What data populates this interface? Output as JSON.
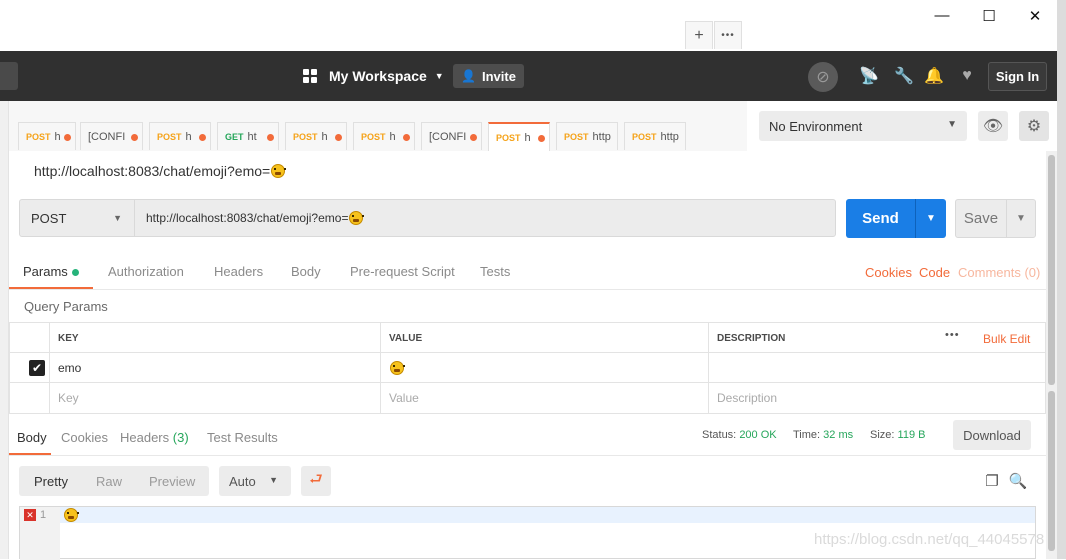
{
  "window": {
    "minimize": "—",
    "maximize": "☐",
    "close": "✕"
  },
  "header": {
    "workspace_label": "My Workspace",
    "invite_label": "Invite",
    "signin_label": "Sign In"
  },
  "tabs": [
    {
      "method": "POST",
      "url": "h",
      "dot": true
    },
    {
      "method": "",
      "url": "[CONFI",
      "dot": true
    },
    {
      "method": "POST",
      "url": "h",
      "dot": true
    },
    {
      "method": "GET",
      "url": "ht",
      "dot": true
    },
    {
      "method": "POST",
      "url": "h",
      "dot": true
    },
    {
      "method": "POST",
      "url": "h",
      "dot": true
    },
    {
      "method": "",
      "url": "[CONFI",
      "dot": true
    },
    {
      "method": "POST",
      "url": "h",
      "dot": true,
      "active": true
    },
    {
      "method": "POST",
      "url": "http",
      "dot": false
    },
    {
      "method": "POST",
      "url": "http",
      "dot": false
    }
  ],
  "tab_actions": {
    "add": "+",
    "more": "•••"
  },
  "environment": {
    "selected": "No Environment"
  },
  "request": {
    "title": "http://localhost:8083/chat/emoji?emo=",
    "method": "POST",
    "url": "http://localhost:8083/chat/emoji?emo=",
    "send_label": "Send",
    "save_label": "Save"
  },
  "request_tabs": [
    "Params",
    "Authorization",
    "Headers",
    "Body",
    "Pre-request Script",
    "Tests"
  ],
  "request_links": {
    "cookies": "Cookies",
    "code": "Code",
    "comments": "Comments (0)"
  },
  "query_params": {
    "title": "Query Params",
    "columns": {
      "key": "KEY",
      "value": "VALUE",
      "description": "DESCRIPTION"
    },
    "bulk_edit": "Bulk Edit",
    "row": {
      "key": "emo",
      "checked": true
    },
    "placeholders": {
      "key": "Key",
      "value": "Value",
      "description": "Description"
    }
  },
  "response": {
    "tabs": {
      "body": "Body",
      "cookies": "Cookies",
      "headers": "Headers",
      "headers_count": "(3)",
      "tests": "Test Results"
    },
    "status_label": "Status:",
    "status_value": "200 OK",
    "time_label": "Time:",
    "time_value": "32 ms",
    "size_label": "Size:",
    "size_value": "119 B",
    "download_label": "Download",
    "formats": [
      "Pretty",
      "Raw",
      "Preview"
    ],
    "auto_label": "Auto",
    "line_number": "1"
  },
  "watermark": "https://blog.csdn.net/qq_44045578"
}
